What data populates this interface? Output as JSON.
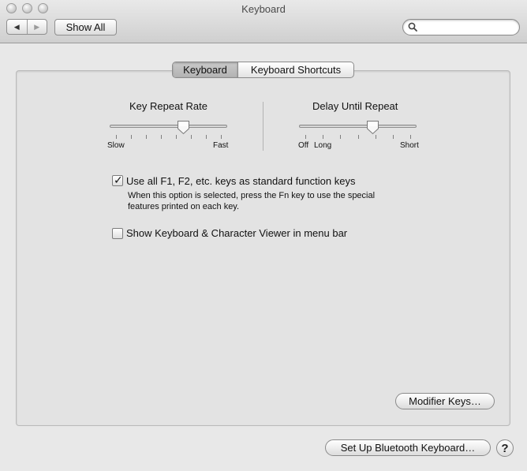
{
  "window": {
    "title": "Keyboard"
  },
  "toolbar": {
    "back_glyph": "◀",
    "forward_glyph": "▶",
    "show_all_label": "Show All",
    "search": {
      "value": "",
      "placeholder": ""
    }
  },
  "tabs": [
    {
      "label": "Keyboard",
      "selected": true
    },
    {
      "label": "Keyboard Shortcuts",
      "selected": false
    }
  ],
  "key_repeat_rate": {
    "label": "Key Repeat Rate",
    "min_label": "Slow",
    "max_label": "Fast",
    "value_fraction": 0.64,
    "tick_count": 8
  },
  "delay_until_repeat": {
    "label": "Delay Until Repeat",
    "off_label": "Off",
    "min_label": "Long",
    "max_label": "Short",
    "value_fraction": 0.64,
    "tick_count": 7
  },
  "options": {
    "fn_keys": {
      "label": "Use all F1, F2, etc. keys as standard function keys",
      "checked": true,
      "description_line1": "When this option is selected, press the Fn key to use the special",
      "description_line2": "features printed on each key."
    },
    "keyboard_viewer": {
      "label": "Show Keyboard & Character Viewer in menu bar",
      "checked": false
    }
  },
  "buttons": {
    "modifier_keys": "Modifier Keys…",
    "bluetooth": "Set Up Bluetooth Keyboard…",
    "help": "?"
  },
  "colors": {
    "window_bg": "#e8e8e8",
    "pane_bg": "#e3e3e3",
    "text": "#111111"
  }
}
